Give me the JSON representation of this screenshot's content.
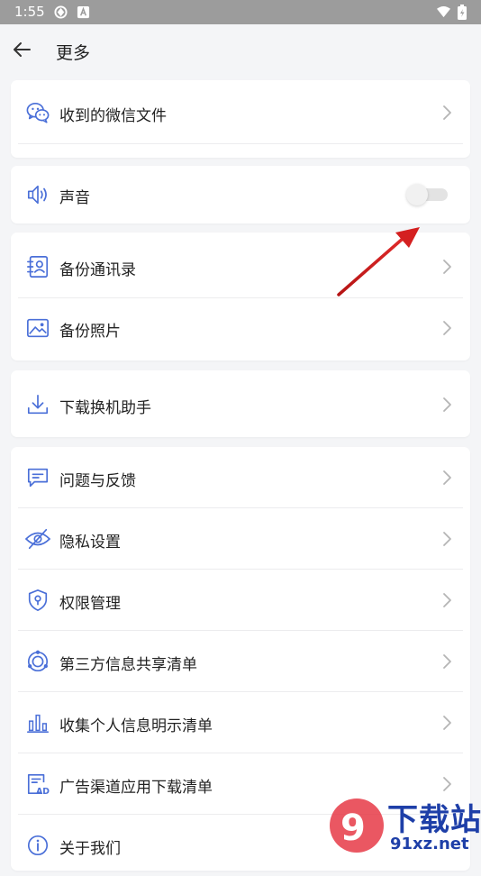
{
  "status_bar": {
    "time": "1:55"
  },
  "header": {
    "title": "更多"
  },
  "items": {
    "wechat_files": {
      "label": "收到的微信文件",
      "icon": "wechat-icon"
    },
    "sound": {
      "label": "声音",
      "icon": "speaker-icon",
      "toggle_on": false
    },
    "backup_contacts": {
      "label": "备份通讯录",
      "icon": "contacts-book-icon"
    },
    "backup_photos": {
      "label": "备份照片",
      "icon": "image-icon"
    },
    "download_helper": {
      "label": "下载换机助手",
      "icon": "download-icon"
    },
    "feedback": {
      "label": "问题与反馈",
      "icon": "chat-bubble-icon"
    },
    "privacy": {
      "label": "隐私设置",
      "icon": "eye-off-icon"
    },
    "permissions": {
      "label": "权限管理",
      "icon": "shield-pin-icon"
    },
    "third_party": {
      "label": "第三方信息共享清单",
      "icon": "share-circle-icon"
    },
    "personal_info": {
      "label": "收集个人信息明示清单",
      "icon": "bar-chart-icon"
    },
    "ad_channel": {
      "label": "广告渠道应用下载清单",
      "icon": "ad-document-icon"
    },
    "about": {
      "label": "关于我们",
      "icon": "info-icon"
    }
  },
  "watermark": {
    "text": "下载站",
    "url": "91xz.net"
  },
  "colors": {
    "accent": "#4a6fd8",
    "background": "#f4f5f7",
    "annotation_arrow": "#d42020"
  }
}
